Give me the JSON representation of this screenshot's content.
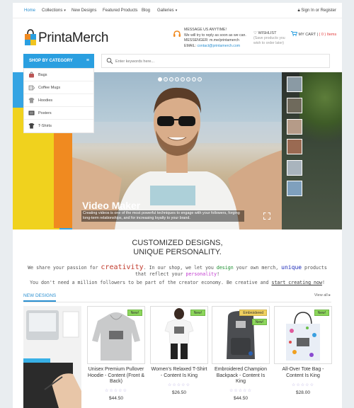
{
  "topnav": {
    "home": "Home",
    "collections": "Collections",
    "new_designs": "New Designs",
    "featured": "Featured Products",
    "blog": "Blog",
    "galleries": "Galleries",
    "signin": "Sign In or Register"
  },
  "brand": {
    "name": "PrintaMerch",
    "accent": "#2a9fe0"
  },
  "contact": {
    "line1": "MESSAGE US ANYTIME!",
    "line2": "We will try to reply as soon as we can.",
    "line3": "MESSENGER: m.me/printamerch",
    "line4_label": "EMAIL: ",
    "line4_email": "contact@printamerch.com"
  },
  "wishlist": {
    "title": "WISHLIST",
    "sub1": "(Save products you",
    "sub2": "wish to order later)"
  },
  "cart": {
    "label": "MY CART",
    "count": "( 0 ) Items"
  },
  "categories": {
    "button": "SHOP BY CATEGORY",
    "items": [
      {
        "label": "Bags",
        "icon": "bag-icon"
      },
      {
        "label": "Coffee Mugs",
        "icon": "mug-icon"
      },
      {
        "label": "Hoodies",
        "icon": "hoodie-icon"
      },
      {
        "label": "Posters",
        "icon": "poster-icon"
      },
      {
        "label": "T-Shirts",
        "icon": "tshirt-icon"
      }
    ]
  },
  "search": {
    "placeholder": "Enter keywords here..."
  },
  "hero": {
    "title": "Video Maker",
    "subtitle": "Creating videos is one of the most powerful techniques to engage with your followers, forging long-term relationships, and for increasing loyalty to your brand.",
    "slides": 8,
    "active_slide": 1
  },
  "tagline": {
    "line1": "CUSTOMIZED DESIGNS,",
    "line2": "UNIQUE PERSONALITY."
  },
  "share": {
    "p1": "We share your passion for ",
    "creativity": "creativity",
    "p2": ". In our shop, we let you ",
    "design": "design",
    "p3": " your own merch, ",
    "unique": "unique",
    "p4": " products",
    "p5": "that reflect your ",
    "personality": "personality",
    "p6": "!",
    "p7": "You don't need a million followers to be part of the creator economy. Be creative and ",
    "link": "start creating now",
    "p8": "!"
  },
  "new_designs": {
    "title": "NEW DESIGNS",
    "view_all": "View all",
    "products": [
      {
        "name": "Unisex Premium Pullover Hoodie - Content (Front & Back)",
        "price": "$44.50",
        "badges": [
          "New!"
        ],
        "stars": "☆☆☆☆☆"
      },
      {
        "name": "Women's Relaxed T-Shirt - Content Is King",
        "price": "$26.50",
        "badges": [
          "New!"
        ],
        "stars": "☆☆☆☆☆"
      },
      {
        "name": "Embroidered Champion Backpack - Content Is King",
        "price": "$44.50",
        "badges": [
          "Embroidered",
          "New!"
        ],
        "stars": "☆☆☆☆☆"
      },
      {
        "name": "All-Over Tote Bag - Content Is King",
        "price": "$28.00",
        "badges": [
          "New!"
        ],
        "stars": "☆☆☆☆☆"
      }
    ]
  }
}
